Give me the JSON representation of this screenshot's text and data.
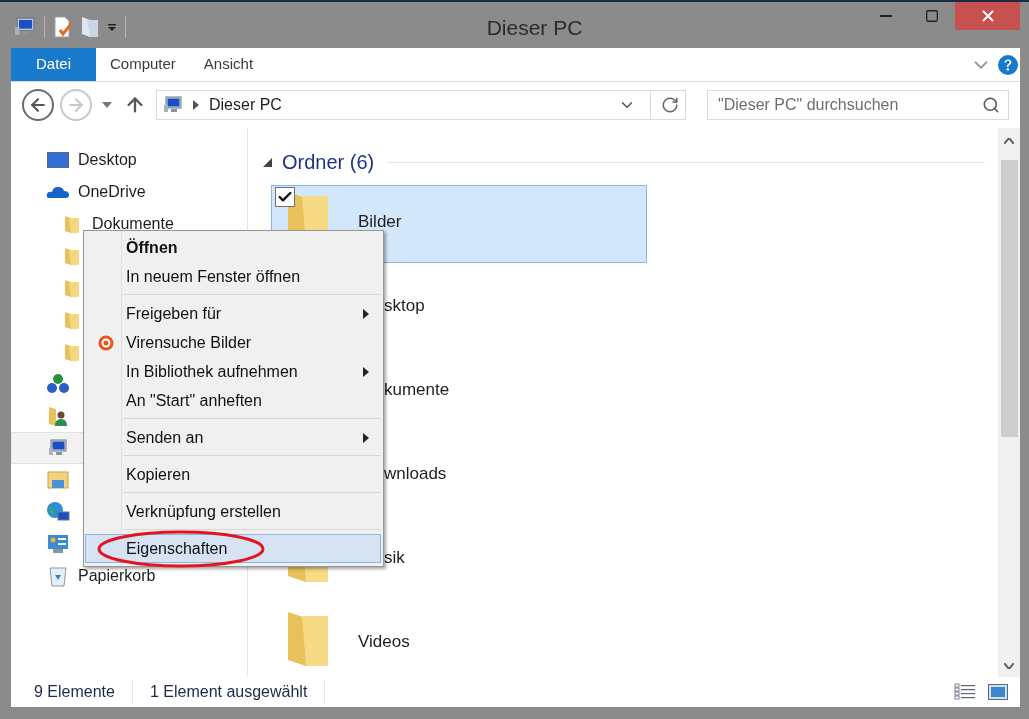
{
  "window": {
    "title": "Dieser PC"
  },
  "ribbon": {
    "tabs": [
      {
        "label": "Datei",
        "kind": "file"
      },
      {
        "label": "Computer",
        "kind": "tab"
      },
      {
        "label": "Ansicht",
        "kind": "tab"
      }
    ]
  },
  "navigation": {
    "back_enabled": true,
    "forward_enabled": false,
    "address": "Dieser PC",
    "search": {
      "placeholder": "\"Dieser PC\" durchsuchen"
    }
  },
  "sidebar": {
    "items": [
      {
        "kind": "desktop",
        "label": "Desktop",
        "selected": false
      },
      {
        "kind": "cloud",
        "label": "OneDrive",
        "selected": false,
        "children": [
          {
            "kind": "folder",
            "label": "Dokumente",
            "selected": false
          },
          {
            "kind": "folder",
            "selected": false
          },
          {
            "kind": "folder",
            "selected": false
          },
          {
            "kind": "folder",
            "selected": false
          },
          {
            "kind": "folder",
            "selected": false
          }
        ]
      },
      {
        "kind": "network",
        "selected": false
      },
      {
        "kind": "user",
        "selected": false
      },
      {
        "kind": "pc",
        "selected": true
      },
      {
        "kind": "library",
        "selected": false
      },
      {
        "kind": "globe",
        "selected": false
      },
      {
        "kind": "control",
        "selected": false
      },
      {
        "kind": "trash",
        "label": "Papierkorb",
        "selected": false
      }
    ]
  },
  "content": {
    "group": {
      "title": "Ordner (6)",
      "expanded": true
    },
    "folders": [
      {
        "label": "Bilder",
        "selected": true,
        "checked": true,
        "cut": false,
        "icon_visible": true
      },
      {
        "label": "sktop",
        "selected": false,
        "checked": false,
        "cut": true,
        "icon_visible": false
      },
      {
        "label": "kumente",
        "selected": false,
        "checked": false,
        "cut": true,
        "icon_visible": false
      },
      {
        "label": "wnloads",
        "selected": false,
        "checked": false,
        "cut": true,
        "icon_visible": false
      },
      {
        "label": "sik",
        "selected": false,
        "checked": false,
        "cut": true,
        "icon_visible": true
      },
      {
        "label": "Videos",
        "selected": false,
        "checked": false,
        "cut": false,
        "icon_visible": true
      }
    ]
  },
  "status_bar": {
    "item_count": "9 Elemente",
    "selection": "1 Element ausgewählt"
  },
  "context_menu": {
    "groups": [
      [
        {
          "label": "Öffnen",
          "default": true,
          "submenu": false,
          "selected": false
        },
        {
          "label": "In neuem Fenster öffnen",
          "default": false,
          "submenu": false,
          "selected": false
        }
      ],
      [
        {
          "label": "Freigeben für",
          "default": false,
          "submenu": true,
          "selected": false
        },
        {
          "label": "Virensuche Bilder",
          "default": false,
          "submenu": false,
          "selected": false,
          "kind": "antivirus"
        },
        {
          "label": "In Bibliothek aufnehmen",
          "default": false,
          "submenu": true,
          "selected": false
        },
        {
          "label": "An \"Start\" anheften",
          "default": false,
          "submenu": false,
          "selected": false
        }
      ],
      [
        {
          "label": "Senden an",
          "default": false,
          "submenu": true,
          "selected": false
        }
      ],
      [
        {
          "label": "Kopieren",
          "default": false,
          "submenu": false,
          "selected": false
        }
      ],
      [
        {
          "label": "Verknüpfung erstellen",
          "default": false,
          "submenu": false,
          "selected": false
        }
      ],
      [
        {
          "label": "Eigenschaften",
          "default": false,
          "submenu": false,
          "selected": true
        }
      ]
    ]
  }
}
